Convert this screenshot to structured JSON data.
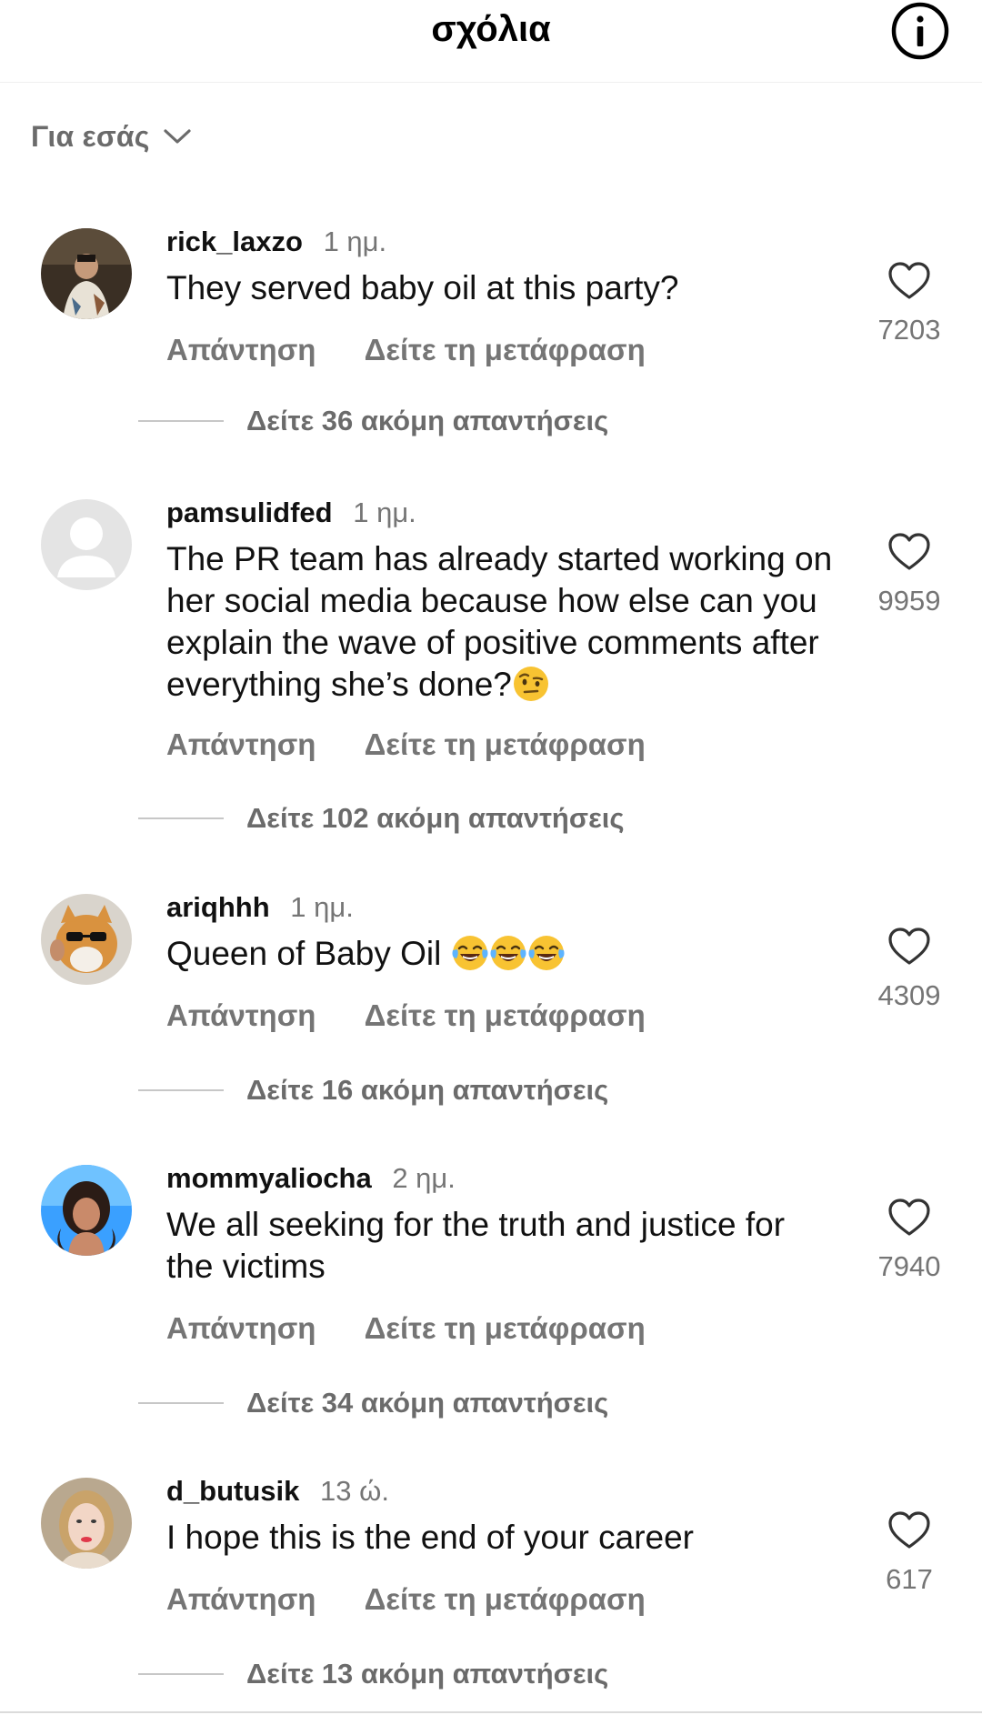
{
  "header": {
    "title": "σχόλια",
    "info_icon": "info-icon"
  },
  "sort": {
    "label": "Για εσάς",
    "icon": "chevron-down-icon"
  },
  "comments": [
    {
      "username": "rick_laxzo",
      "time": "1 ημ.",
      "text": "They served baby oil at this party?",
      "reply_label": "Απάντηση",
      "translate_label": "Δείτε τη μετάφραση",
      "likes": "7203",
      "view_replies": "Δείτε 36 ακόμη απαντήσεις"
    },
    {
      "username": "pamsulidfed",
      "time": "1 ημ.",
      "text": "The PR team has already started working on her social media because how else can you explain the wave of positive comments after everything she’s done?",
      "emoji": "raised-eyebrow-face",
      "reply_label": "Απάντηση",
      "translate_label": "Δείτε τη μετάφραση",
      "likes": "9959",
      "view_replies": "Δείτε 102 ακόμη απαντήσεις"
    },
    {
      "username": "ariqhhh",
      "time": "1 ημ.",
      "text": "Queen of Baby Oil",
      "emoji": "tears-of-joy-face x3",
      "reply_label": "Απάντηση",
      "translate_label": "Δείτε τη μετάφραση",
      "likes": "4309",
      "view_replies": "Δείτε 16 ακόμη απαντήσεις"
    },
    {
      "username": "mommyaliocha",
      "time": "2 ημ.",
      "text": "We all seeking for the truth and justice for the victims",
      "reply_label": "Απάντηση",
      "translate_label": "Δείτε τη μετάφραση",
      "likes": "7940",
      "view_replies": "Δείτε 34 ακόμη απαντήσεις"
    },
    {
      "username": "d_butusik",
      "time": "13 ώ.",
      "text": "I hope this is the end of your career",
      "reply_label": "Απάντηση",
      "translate_label": "Δείτε τη μετάφραση",
      "likes": "617",
      "view_replies": "Δείτε 13 ακόμη απαντήσεις"
    }
  ],
  "colors": {
    "text": "#111111",
    "secondary": "#757575",
    "divider": "#c7c7c7"
  }
}
